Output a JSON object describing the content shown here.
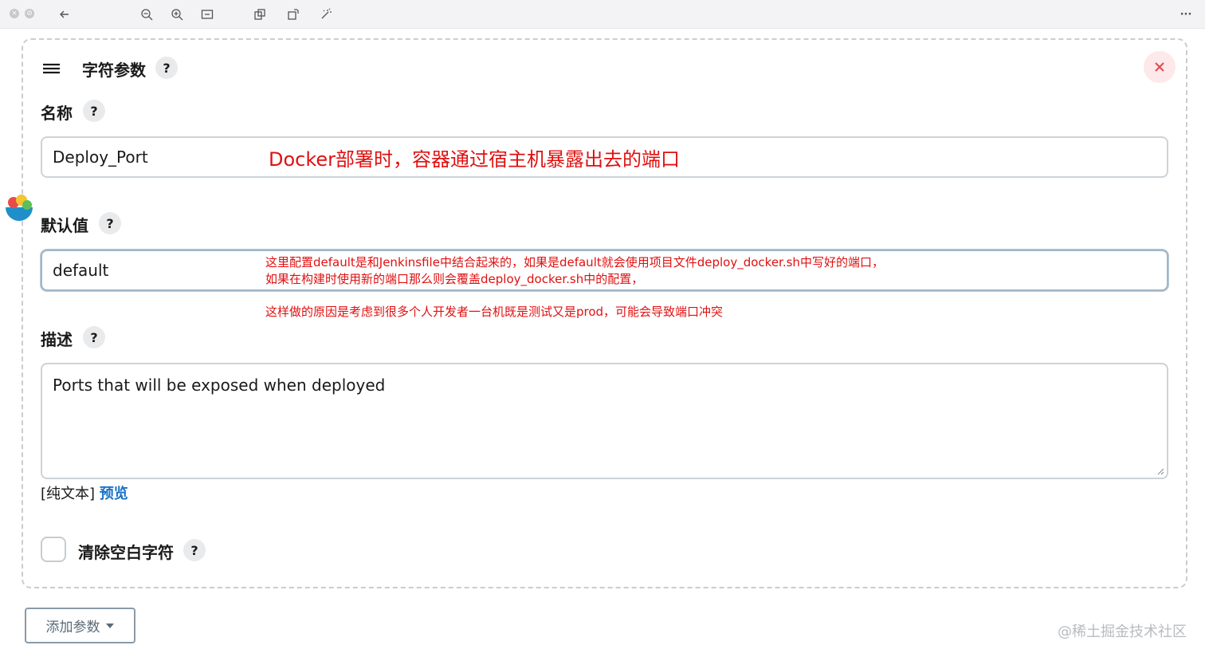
{
  "toolbar": {
    "icons": [
      "close-icon",
      "minimize-icon",
      "back-arrow-icon",
      "zoom-out-icon",
      "zoom-in-icon",
      "fit-icon",
      "copy-icon",
      "rotate-icon",
      "magic-wand-icon",
      "more-icon"
    ],
    "more_label": "···"
  },
  "section": {
    "title": "字符参数",
    "help": "?"
  },
  "name_field": {
    "label": "名称",
    "help": "?",
    "value": "Deploy_Port",
    "annotation": "Docker部署时，容器通过宿主机暴露出去的端口"
  },
  "default_field": {
    "label": "默认值",
    "help": "?",
    "value": "default",
    "annotation_line1": "这里配置default是和Jenkinsfile中结合起来的，如果是default就会使用项目文件deploy_docker.sh中写好的端口，",
    "annotation_line2": "如果在构建时使用新的端口那么则会覆盖deploy_docker.sh中的配置，",
    "annotation_line3": "这样做的原因是考虑到很多个人开发者一台机既是测试又是prod，可能会导致端口冲突"
  },
  "description_field": {
    "label": "描述",
    "help": "?",
    "value": "Ports that will be exposed when deployed",
    "format_plain": "[纯文本]",
    "format_preview": "预览"
  },
  "trim_option": {
    "label": "清除空白字符",
    "help": "?",
    "checked": false
  },
  "add_param_button": {
    "label": "添加参数"
  },
  "watermark": "@稀土掘金技术社区",
  "colors": {
    "annotation_red": "#e01010",
    "link_blue": "#1a73c8",
    "close_red": "#e5484d"
  }
}
